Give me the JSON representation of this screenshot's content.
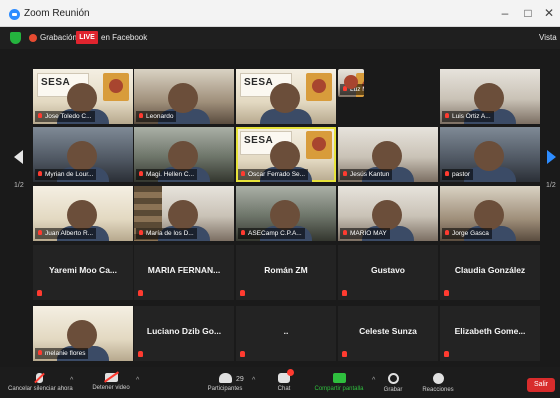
{
  "window": {
    "title": "Zoom Reunión",
    "minimize_icon": "–",
    "maximize_icon": "□",
    "close_icon": "✕"
  },
  "infobar": {
    "recording": "Grabación",
    "live": "LIVE",
    "live_target": "en Facebook",
    "view": "Vista"
  },
  "navigation": {
    "prev_page": "1/2",
    "next_page": "1/2"
  },
  "participants": [
    {
      "name": "Jose Toledo C...",
      "type": "video",
      "variant": "sesa",
      "sesa": "SESA"
    },
    {
      "name": "Leonardo",
      "type": "video",
      "variant": "c2"
    },
    {
      "name": "",
      "type": "video",
      "variant": "sesa",
      "sesa": "SESA"
    },
    {
      "name": "Luz Miguel...",
      "type": "video",
      "variant": "crest"
    },
    {
      "name": "Luis Ortiz A...",
      "type": "video",
      "variant": "c3"
    },
    {
      "name": "Myrian de Lour...",
      "type": "video",
      "variant": "c5"
    },
    {
      "name": "Magi. Hellen C...",
      "type": "video",
      "variant": "c4"
    },
    {
      "name": "Oscar Ferrado Se...",
      "type": "video",
      "variant": "sesa-active",
      "active": true,
      "sesa": "SESA"
    },
    {
      "name": "Jesús Kantun",
      "type": "video",
      "variant": "c3"
    },
    {
      "name": "pastor",
      "type": "video",
      "variant": "c5"
    },
    {
      "name": "Juan Alberto R...",
      "type": "video",
      "variant": "c1"
    },
    {
      "name": "María de los D...",
      "type": "video",
      "variant": "shelf"
    },
    {
      "name": "ASECamp C.P.A...",
      "type": "video",
      "variant": "c4"
    },
    {
      "name": "MARIO MAY",
      "type": "video",
      "variant": "c3"
    },
    {
      "name": "Jorge Gasca",
      "type": "video",
      "variant": "c2"
    },
    {
      "name": "Yaremi Moo Ca...",
      "type": "name"
    },
    {
      "name": "MARIA FERNAN...",
      "type": "name"
    },
    {
      "name": "Román ZM",
      "type": "name"
    },
    {
      "name": "Gustavo",
      "type": "name"
    },
    {
      "name": "Claudia González",
      "type": "name"
    },
    {
      "name": "melanie flores",
      "type": "video",
      "variant": "c1"
    },
    {
      "name": "Luciano Dzib Go...",
      "type": "name"
    },
    {
      "name": "..",
      "type": "name"
    },
    {
      "name": "Celeste Sunza",
      "type": "name"
    },
    {
      "name": "Elizabeth Gome...",
      "type": "name"
    }
  ],
  "toolbar": {
    "mute": "Cancelar silenciar ahora",
    "video": "Detener video",
    "participants": "Participantes",
    "participant_count": "29",
    "chat": "Chat",
    "share": "Compartir pantalla",
    "record": "Grabar",
    "reactions": "Reacciones",
    "leave": "Salir",
    "caret": "^"
  },
  "colors": {
    "live": "#e0242e",
    "share": "#2fbf3e",
    "active_speaker": "#e7e33a",
    "leave": "#d82c2c"
  }
}
